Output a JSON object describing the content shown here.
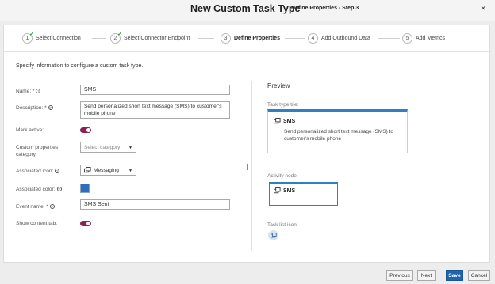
{
  "header": {
    "title": "New Custom Task Type",
    "subtitle": "Define Properties - Step 3",
    "close_glyph": "×"
  },
  "steps": [
    {
      "number": "1",
      "label": "Select Connection",
      "completed": true
    },
    {
      "number": "2",
      "label": "Select Connector Endpoint",
      "completed": true
    },
    {
      "number": "3",
      "label": "Define Properties",
      "current": true
    },
    {
      "number": "4",
      "label": "Add Outbound Data"
    },
    {
      "number": "5",
      "label": "Add Metrics"
    }
  ],
  "intro": "Specify information to configure a custom task type.",
  "form": {
    "name": {
      "label": "Name: *",
      "value": "SMS"
    },
    "description": {
      "label": "Description: *",
      "value": "Send personalized short text message (SMS) to customer's mobile phone"
    },
    "mark_active": {
      "label": "Mark active:",
      "on": true
    },
    "category": {
      "label_line1": "Custom properties",
      "label_line2": "category:",
      "placeholder": "Select category"
    },
    "icon": {
      "label": "Associated icon:",
      "value": "Messaging"
    },
    "color": {
      "label": "Associated color:",
      "value": "#2f6fb8"
    },
    "event_name": {
      "label": "Event name: *",
      "value": "SMS Sent"
    },
    "show_content_tab": {
      "label": "Show content tab:",
      "on": true
    }
  },
  "preview": {
    "title": "Preview",
    "tile_label": "Task type tile:",
    "tile_name": "SMS",
    "tile_desc": "Send personalized short text message (SMS) to customer's mobile phone",
    "node_label": "Activity node:",
    "node_name": "SMS",
    "task_list_label": "Task list icon:"
  },
  "buttons": {
    "previous": "Previous",
    "next": "Next",
    "save": "Save",
    "cancel": "Cancel"
  },
  "colors": {
    "accent": "#1f64b0",
    "toggle_on": "#8b2252",
    "tile_border": "#2f7fc8"
  },
  "icons": {
    "help": "help-circle-icon",
    "messaging": "message-icon",
    "check": "check-icon"
  }
}
